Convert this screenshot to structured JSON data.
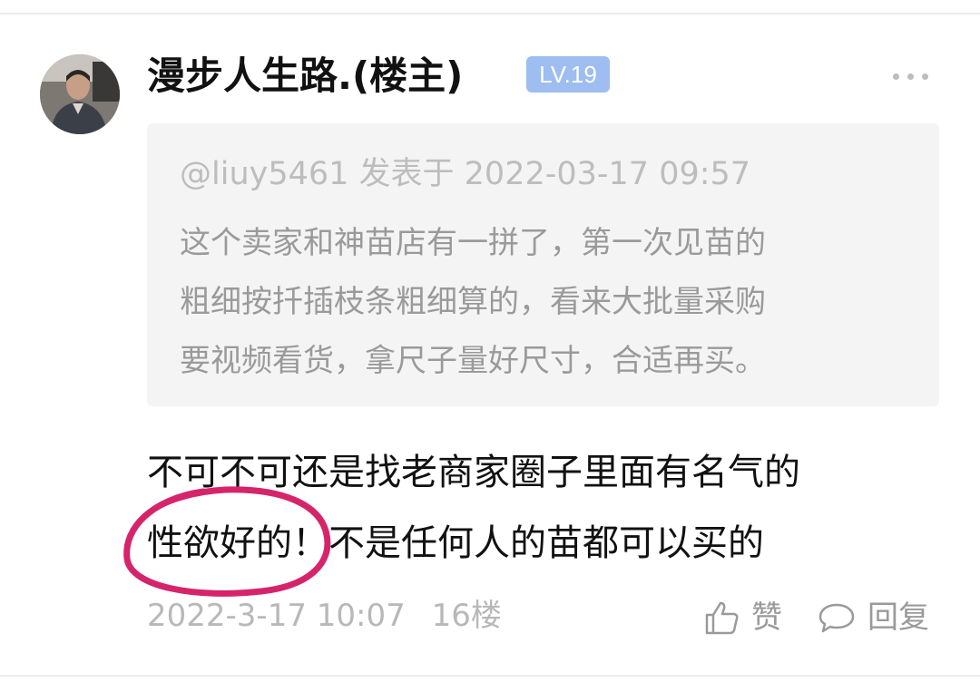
{
  "post": {
    "author": "漫步人生路.(楼主)",
    "level": "LV.19",
    "quote": {
      "meta": "@liuy5461 发表于 2022-03-17 09:57",
      "lines": [
        "这个卖家和神苗店有一拼了，第一次见苗的",
        "粗细按扦插枝条粗细算的，看来大批量采购",
        "要视频看货，拿尺子量好尺寸，合适再买。"
      ]
    },
    "body_lines": [
      "不可不可还是找老商家圈子里面有名气的",
      "性欲好的！不是任何人的苗都可以买的"
    ],
    "timestamp": "2022-3-17 10:07",
    "floor": "16楼",
    "like_label": "赞",
    "reply_label": "回复"
  },
  "colors": {
    "badge": "#9ebdf0",
    "annotation": "#d6246b",
    "quote_bg": "#f4f4f4"
  }
}
